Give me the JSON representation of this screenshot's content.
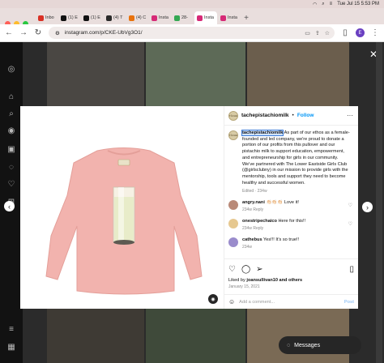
{
  "menubar": {
    "time": "Tue Jul 15  5:53 PM"
  },
  "tabs": [
    {
      "label": "Inbo",
      "color": "#d93025"
    },
    {
      "label": "(1) E",
      "color": "#111111"
    },
    {
      "label": "(1) E",
      "color": "#111111"
    },
    {
      "label": "(4) T",
      "color": "#2a2a2a"
    },
    {
      "label": "(4) C",
      "color": "#e8720c"
    },
    {
      "label": "Insta",
      "color": "#d62976"
    },
    {
      "label": "28-",
      "color": "#34a853"
    },
    {
      "label": "Insta",
      "color": "#d62976"
    },
    {
      "label": "Insta",
      "color": "#d62976"
    }
  ],
  "address": {
    "url": "instagram.com/p/CKE-UbVg3O1/"
  },
  "profile_initial": "E",
  "post": {
    "username": "tachepistachiomilk",
    "follow_label": "Follow",
    "caption_user": "tachepistachiomilk",
    "caption": "As part of our ethos as a female-founded and led company, we're proud to donate a portion of our profits from this pullover and our pistachio milk to support education, empowerment, and entrepreneurship for girls in our community. We've partnered with The Lower Eastside Girls Club (@girlsclubny) in our mission to provide girls with the mentorship, tools and support they need to become healthy and successful women.",
    "caption_meta": "Edited · 234w",
    "comments": [
      {
        "user": "angry.nani",
        "text": "👏🏻👏🏻👏🏻 Love it!",
        "meta": "234w   Reply",
        "avatar_color": "#b98a78"
      },
      {
        "user": "onestripechaico",
        "text": "Here for this!!",
        "meta": "234w   Reply",
        "avatar_color": "#e6c890"
      },
      {
        "user": "cathebus",
        "text": "Yes!!! It's so true!!",
        "meta": "234w",
        "avatar_color": "#9a8ccc"
      }
    ],
    "liked_by_prefix": "Liked by",
    "liked_by_user": "joansullivan10",
    "liked_by_suffix": "and others",
    "date": "January 15, 2021",
    "add_comment_placeholder": "Add a comment...",
    "post_label": "Post"
  },
  "messages_label": "Messages"
}
